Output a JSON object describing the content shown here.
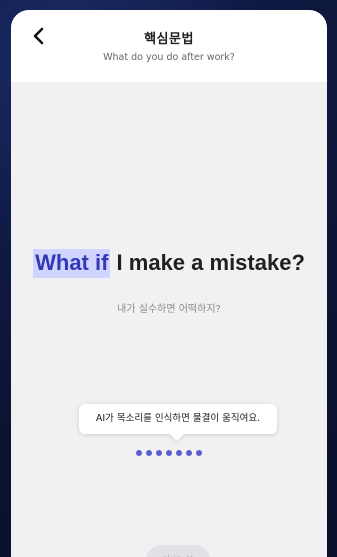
{
  "header": {
    "title": "핵심문법",
    "subtitle": "What do you do after work?",
    "back_icon": "chevron-left-icon"
  },
  "sentence": {
    "highlight": "What if",
    "rest": " I make a mistake?",
    "highlight_color": "#3438b7",
    "highlight_bg": "#cfd5ff"
  },
  "translation": "내가 실수하면 어떡하지?",
  "tooltip": {
    "text": "AI가 목소리를 인식하면 물결이 움직여요."
  },
  "voice_wave": {
    "dot_count": 7,
    "color": "#5a5fd0"
  },
  "skip": {
    "label": "skip ✕"
  }
}
